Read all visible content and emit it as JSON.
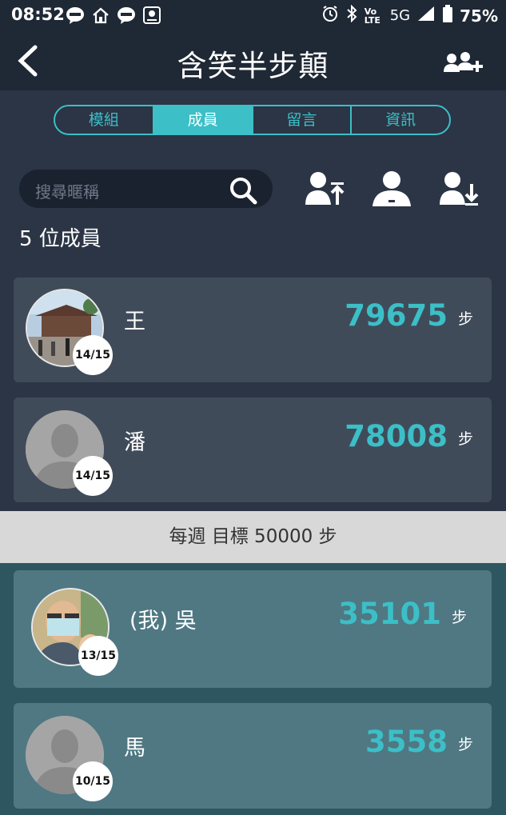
{
  "status_bar": {
    "time": "08:52",
    "network": "5G",
    "volte": "Vo LTE",
    "battery": "75%"
  },
  "header": {
    "title": "含笑半步顛"
  },
  "tabs": [
    {
      "label": "模組",
      "active": false
    },
    {
      "label": "成員",
      "active": true
    },
    {
      "label": "留言",
      "active": false
    },
    {
      "label": "資訊",
      "active": false
    }
  ],
  "search": {
    "placeholder": "搜尋暱稱"
  },
  "member_count": "5 位成員",
  "goal": {
    "text": "每週 目標 50000 步"
  },
  "members": [
    {
      "name": "王",
      "steps": "79675",
      "unit": "步",
      "days": "14/15",
      "avatar": "photo-temple"
    },
    {
      "name": "潘",
      "steps": "78008",
      "unit": "步",
      "days": "14/15",
      "avatar": "default-person"
    },
    {
      "name": "(我) 吳",
      "steps": "35101",
      "unit": "步",
      "days": "13/15",
      "avatar": "photo-selfie"
    },
    {
      "name": "馬",
      "steps": "3558",
      "unit": "步",
      "days": "10/15",
      "avatar": "default-person"
    }
  ],
  "colors": {
    "accent": "#3cbfc7",
    "background": "#2b3545",
    "card": "#404b5a",
    "card_below_goal": "#4f7883"
  }
}
